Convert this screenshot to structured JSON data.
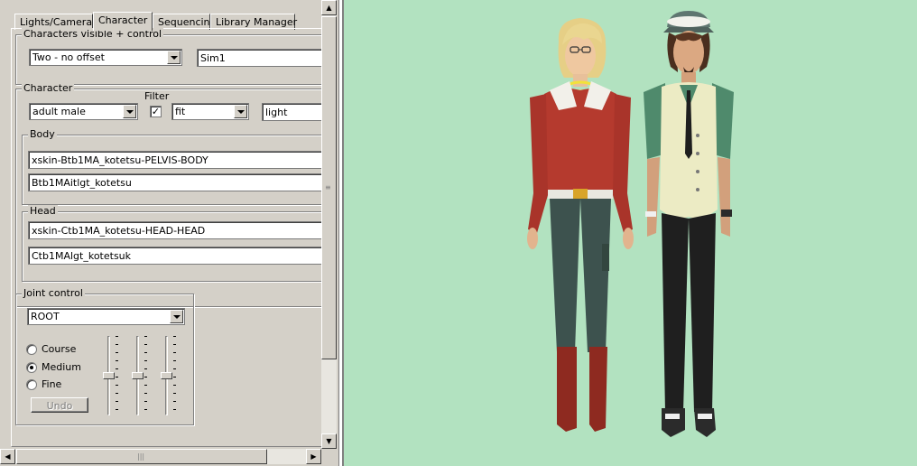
{
  "tabs": [
    {
      "label": "Lights/Camera"
    },
    {
      "label": "Character"
    },
    {
      "label": "Sequencing"
    },
    {
      "label": "Library Manager"
    }
  ],
  "visibility": {
    "legend": "Characters visible + control",
    "mode": "Two - no offset",
    "sim": "Sim1"
  },
  "character": {
    "legend": "Character",
    "filter_label": "Filter",
    "type": "adult male",
    "filter_checked": "✓",
    "fit": "fit",
    "skin": "light",
    "body": {
      "legend": "Body",
      "mesh": "xskin-Btb1MA_kotetsu-PELVIS-BODY",
      "texture": "Btb1MAitlgt_kotetsu"
    },
    "head": {
      "legend": "Head",
      "mesh": "xskin-Ctb1MA_kotetsu-HEAD-HEAD",
      "texture": "Ctb1MAlgt_kotetsuk"
    }
  },
  "joint": {
    "legend": "Joint control",
    "selected": "ROOT",
    "options": [
      {
        "label": "Course",
        "checked": false
      },
      {
        "label": "Medium",
        "checked": true
      },
      {
        "label": "Fine",
        "checked": false
      }
    ],
    "undo_label": "Undo",
    "sliders": [
      0.5,
      0.5,
      0.5
    ]
  },
  "scroll": {
    "up": "▲",
    "down": "▼",
    "left": "◀",
    "right": "▶",
    "grip_v": "≡",
    "grip_h": "|||"
  },
  "colors": {
    "viewport_bg": "#b2e2c0",
    "panel_bg": "#d4d0c8"
  }
}
